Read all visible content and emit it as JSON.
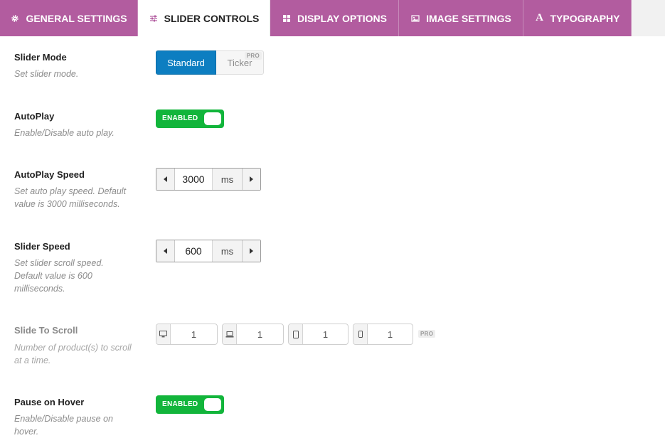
{
  "tabs": [
    {
      "label": "GENERAL SETTINGS",
      "icon": "gear-icon"
    },
    {
      "label": "SLIDER CONTROLS",
      "icon": "sliders-icon",
      "active": true
    },
    {
      "label": "DISPLAY OPTIONS",
      "icon": "grid-icon"
    },
    {
      "label": "IMAGE SETTINGS",
      "icon": "image-icon"
    },
    {
      "label": "TYPOGRAPHY",
      "icon": "font-icon"
    }
  ],
  "slider_mode": {
    "label": "Slider Mode",
    "desc": "Set slider mode.",
    "options": [
      "Standard",
      "Ticker"
    ],
    "selected": "Standard",
    "pro": "PRO"
  },
  "autoplay": {
    "label": "AutoPlay",
    "desc": "Enable/Disable auto play.",
    "toggle": "ENABLED"
  },
  "autoplay_speed": {
    "label": "AutoPlay Speed",
    "desc": "Set auto play speed. Default value is 3000 milliseconds.",
    "value": "3000",
    "unit": "ms"
  },
  "slider_speed": {
    "label": "Slider Speed",
    "desc": "Set slider scroll speed. Default value is 600 milliseconds.",
    "value": "600",
    "unit": "ms"
  },
  "slide_to_scroll": {
    "label": "Slide To Scroll",
    "desc": "Number of product(s) to scroll at a time.",
    "values": [
      "1",
      "1",
      "1",
      "1"
    ],
    "devices": [
      "desktop-icon",
      "laptop-icon",
      "tablet-icon",
      "mobile-icon"
    ],
    "pro": "PRO"
  },
  "pause_on_hover": {
    "label": "Pause on Hover",
    "desc": "Enable/Disable pause on hover.",
    "toggle": "ENABLED"
  },
  "colors": {
    "tab_bg": "#b25c9f",
    "primary": "#0d7ec1",
    "toggle_on": "#12b53b"
  }
}
